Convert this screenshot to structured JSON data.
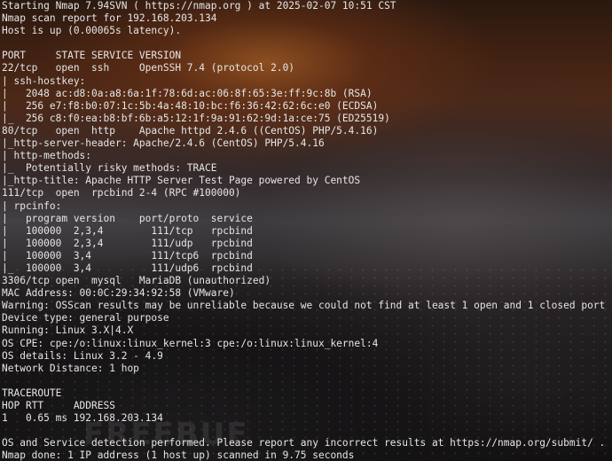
{
  "terminal": {
    "lines": [
      "Starting Nmap 7.94SVN ( https://nmap.org ) at 2025-02-07 10:51 CST",
      "Nmap scan report for 192.168.203.134",
      "Host is up (0.00065s latency).",
      "",
      "PORT     STATE SERVICE VERSION",
      "22/tcp   open  ssh     OpenSSH 7.4 (protocol 2.0)",
      "| ssh-hostkey: ",
      "|   2048 ac:d8:0a:a8:6a:1f:78:6d:ac:06:8f:65:3e:ff:9c:8b (RSA)",
      "|   256 e7:f8:b0:07:1c:5b:4a:48:10:bc:f6:36:42:62:6c:e0 (ECDSA)",
      "|_  256 c8:f0:ea:b8:bf:6b:a5:12:1f:9a:91:62:9d:1a:ce:75 (ED25519)",
      "80/tcp   open  http    Apache httpd 2.4.6 ((CentOS) PHP/5.4.16)",
      "|_http-server-header: Apache/2.4.6 (CentOS) PHP/5.4.16",
      "| http-methods: ",
      "|_  Potentially risky methods: TRACE",
      "|_http-title: Apache HTTP Server Test Page powered by CentOS",
      "111/tcp  open  rpcbind 2-4 (RPC #100000)",
      "| rpcinfo: ",
      "|   program version    port/proto  service",
      "|   100000  2,3,4        111/tcp   rpcbind",
      "|   100000  2,3,4        111/udp   rpcbind",
      "|   100000  3,4          111/tcp6  rpcbind",
      "|_  100000  3,4          111/udp6  rpcbind",
      "3306/tcp open  mysql   MariaDB (unauthorized)",
      "MAC Address: 00:0C:29:34:92:58 (VMware)",
      "Warning: OSScan results may be unreliable because we could not find at least 1 open and 1 closed port",
      "Device type: general purpose",
      "Running: Linux 3.X|4.X",
      "OS CPE: cpe:/o:linux:linux_kernel:3 cpe:/o:linux:linux_kernel:4",
      "OS details: Linux 3.2 - 4.9",
      "Network Distance: 1 hop",
      "",
      "TRACEROUTE",
      "HOP RTT     ADDRESS",
      "1   0.65 ms 192.168.203.134",
      "",
      "OS and Service detection performed. Please report any incorrect results at https://nmap.org/submit/ .",
      "Nmap done: 1 IP address (1 host up) scanned in 9.75 seconds"
    ]
  },
  "watermark": "FREEBUF",
  "colors": {
    "text": "#e6e6e6"
  }
}
